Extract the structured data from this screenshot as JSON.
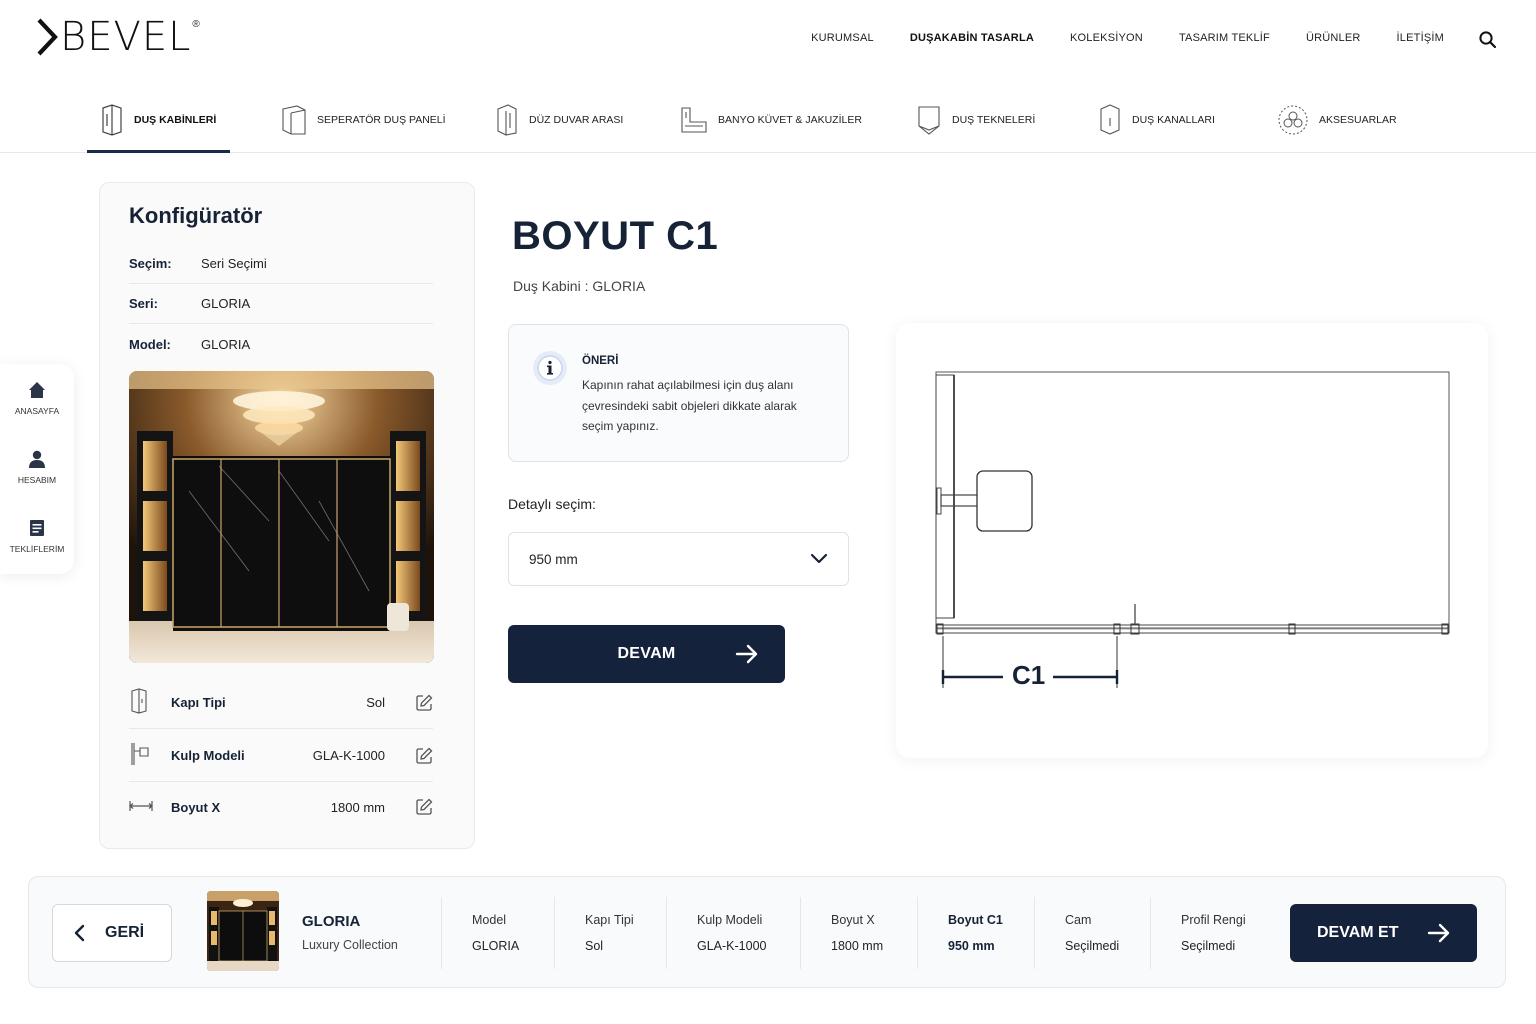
{
  "brand": {
    "name": "BEVEL",
    "reg": "®"
  },
  "topnav": [
    {
      "label": "KURUMSAL",
      "active": false
    },
    {
      "label": "DUŞAKABİN TASARLA",
      "active": true
    },
    {
      "label": "KOLEKSİYON",
      "active": false
    },
    {
      "label": "TASARIM TEKLİF",
      "active": false
    },
    {
      "label": "ÜRÜNLER",
      "active": false
    },
    {
      "label": "İLETİŞİM",
      "active": false
    }
  ],
  "categories": [
    {
      "label": "DUŞ KABİNLERİ",
      "icon": "shower-cabin-icon",
      "active": true
    },
    {
      "label": "SEPERATÖR DUŞ PANELİ",
      "icon": "separator-panel-icon",
      "active": false
    },
    {
      "label": "DÜZ DUVAR ARASI",
      "icon": "wall-niche-icon",
      "active": false
    },
    {
      "label": "BANYO KÜVET & JAKUZİLER",
      "icon": "bathtub-icon",
      "active": false
    },
    {
      "label": "DUŞ TEKNELERİ",
      "icon": "shower-tray-icon",
      "active": false
    },
    {
      "label": "DUŞ KANALLARI",
      "icon": "shower-channel-icon",
      "active": false
    },
    {
      "label": "AKSESUARLAR",
      "icon": "accessories-icon",
      "active": false
    }
  ],
  "siderail": [
    {
      "label": "ANASAYFA",
      "icon": "home-icon"
    },
    {
      "label": "HESABIM",
      "icon": "user-icon"
    },
    {
      "label": "TEKLİFLERİM",
      "icon": "offers-icon"
    }
  ],
  "config": {
    "title": "Konfigüratör",
    "rows": [
      {
        "key": "Seçim:",
        "value": "Seri Seçimi"
      },
      {
        "key": "Seri:",
        "value": "GLORIA"
      },
      {
        "key": "Model:",
        "value": "GLORIA"
      }
    ],
    "selections": [
      {
        "key": "Kapı Tipi",
        "value": "Sol",
        "icon": "door-type-icon"
      },
      {
        "key": "Kulp Modeli",
        "value": "GLA-K-1000",
        "icon": "handle-icon"
      },
      {
        "key": "Boyut X",
        "value": "1800 mm",
        "icon": "dimension-icon"
      }
    ]
  },
  "main": {
    "title": "BOYUT C1",
    "subtitle": "Duş Kabini : GLORIA",
    "tip": {
      "title": "ÖNERİ",
      "lines": [
        "Kapının rahat açılabilmesi için duş alanı",
        "çevresindeki sabit objeleri dikkate alarak",
        "seçim yapınız."
      ]
    },
    "detail_label": "Detaylı seçim:",
    "select_value": "950 mm",
    "continue_label": "DEVAM"
  },
  "drawing": {
    "dimension_label": "C1"
  },
  "bottom": {
    "back_label": "GERİ",
    "product_name": "GLORIA",
    "collection": "Luxury Collection",
    "columns": [
      {
        "key": "Model",
        "value": "GLORIA",
        "bold": false
      },
      {
        "key": "Kapı Tipi",
        "value": "Sol",
        "bold": false
      },
      {
        "key": "Kulp Modeli",
        "value": "GLA-K-1000",
        "bold": false
      },
      {
        "key": "Boyut X",
        "value": "1800 mm",
        "bold": false
      },
      {
        "key": "Boyut C1",
        "value": "950 mm",
        "bold": true
      },
      {
        "key": "Cam",
        "value": "Seçilmedi",
        "bold": false
      },
      {
        "key": "Profil Rengi",
        "value": "Seçilmedi",
        "bold": false
      }
    ],
    "next_label": "DEVAM ET"
  },
  "colors": {
    "navy": "#15223c",
    "text_dark": "#162235",
    "border": "#e6e8ec"
  }
}
